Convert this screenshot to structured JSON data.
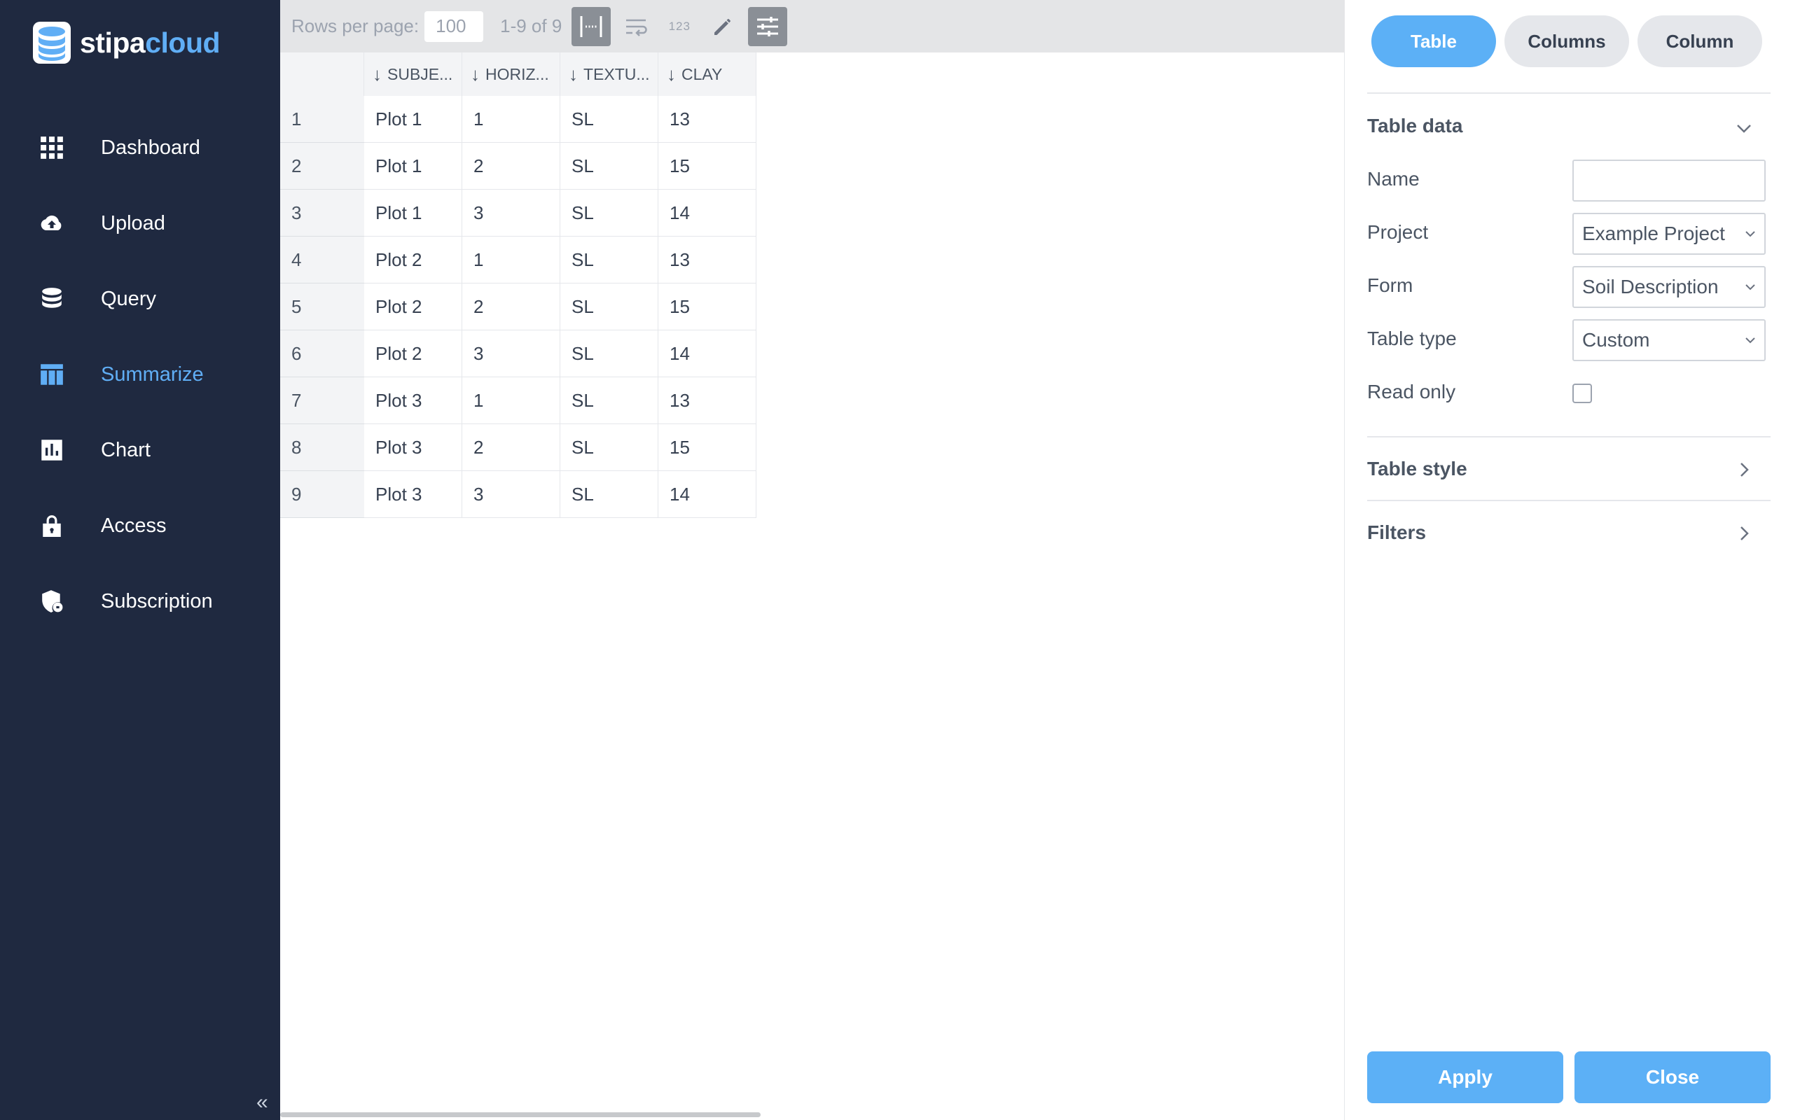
{
  "app": {
    "logo_part1": "stipa",
    "logo_part2": "cloud"
  },
  "sidebar": {
    "items": [
      {
        "label": "Dashboard",
        "icon": "grid-icon"
      },
      {
        "label": "Upload",
        "icon": "cloud-upload-icon"
      },
      {
        "label": "Query",
        "icon": "database-icon"
      },
      {
        "label": "Summarize",
        "icon": "table-icon",
        "active": true
      },
      {
        "label": "Chart",
        "icon": "bar-chart-icon"
      },
      {
        "label": "Access",
        "icon": "lock-icon"
      },
      {
        "label": "Subscription",
        "icon": "shield-icon"
      }
    ],
    "collapse_glyph": "«"
  },
  "toolbar": {
    "rows_per_page_label": "Rows per page:",
    "rows_per_page_value": "100",
    "range_text": "1-9 of 9",
    "number_format_glyph": "123"
  },
  "table": {
    "columns": [
      "SUBJE...",
      "HORIZ...",
      "TEXTU...",
      "CLAY"
    ],
    "sort_glyph": "↓",
    "rows": [
      {
        "n": "1",
        "cells": [
          "Plot 1",
          "1",
          "SL",
          "13"
        ]
      },
      {
        "n": "2",
        "cells": [
          "Plot 1",
          "2",
          "SL",
          "15"
        ]
      },
      {
        "n": "3",
        "cells": [
          "Plot 1",
          "3",
          "SL",
          "14"
        ]
      },
      {
        "n": "4",
        "cells": [
          "Plot 2",
          "1",
          "SL",
          "13"
        ]
      },
      {
        "n": "5",
        "cells": [
          "Plot 2",
          "2",
          "SL",
          "15"
        ]
      },
      {
        "n": "6",
        "cells": [
          "Plot 2",
          "3",
          "SL",
          "14"
        ]
      },
      {
        "n": "7",
        "cells": [
          "Plot 3",
          "1",
          "SL",
          "13"
        ]
      },
      {
        "n": "8",
        "cells": [
          "Plot 3",
          "2",
          "SL",
          "15"
        ]
      },
      {
        "n": "9",
        "cells": [
          "Plot 3",
          "3",
          "SL",
          "14"
        ]
      }
    ]
  },
  "panel": {
    "tabs": [
      {
        "label": "Table",
        "active": true
      },
      {
        "label": "Columns"
      },
      {
        "label": "Column"
      }
    ],
    "table_data": {
      "title": "Table data",
      "name_label": "Name",
      "name_value": "",
      "project_label": "Project",
      "project_value": "Example Project",
      "form_label": "Form",
      "form_value": "Soil Description",
      "table_type_label": "Table type",
      "table_type_value": "Custom",
      "read_only_label": "Read only",
      "read_only_checked": false
    },
    "table_style_title": "Table style",
    "filters_title": "Filters",
    "apply_label": "Apply",
    "close_label": "Close"
  },
  "colors": {
    "sidebar_bg": "#1f2940",
    "accent": "#5cb0f6",
    "toolbar_bg": "#e4e5e7"
  }
}
